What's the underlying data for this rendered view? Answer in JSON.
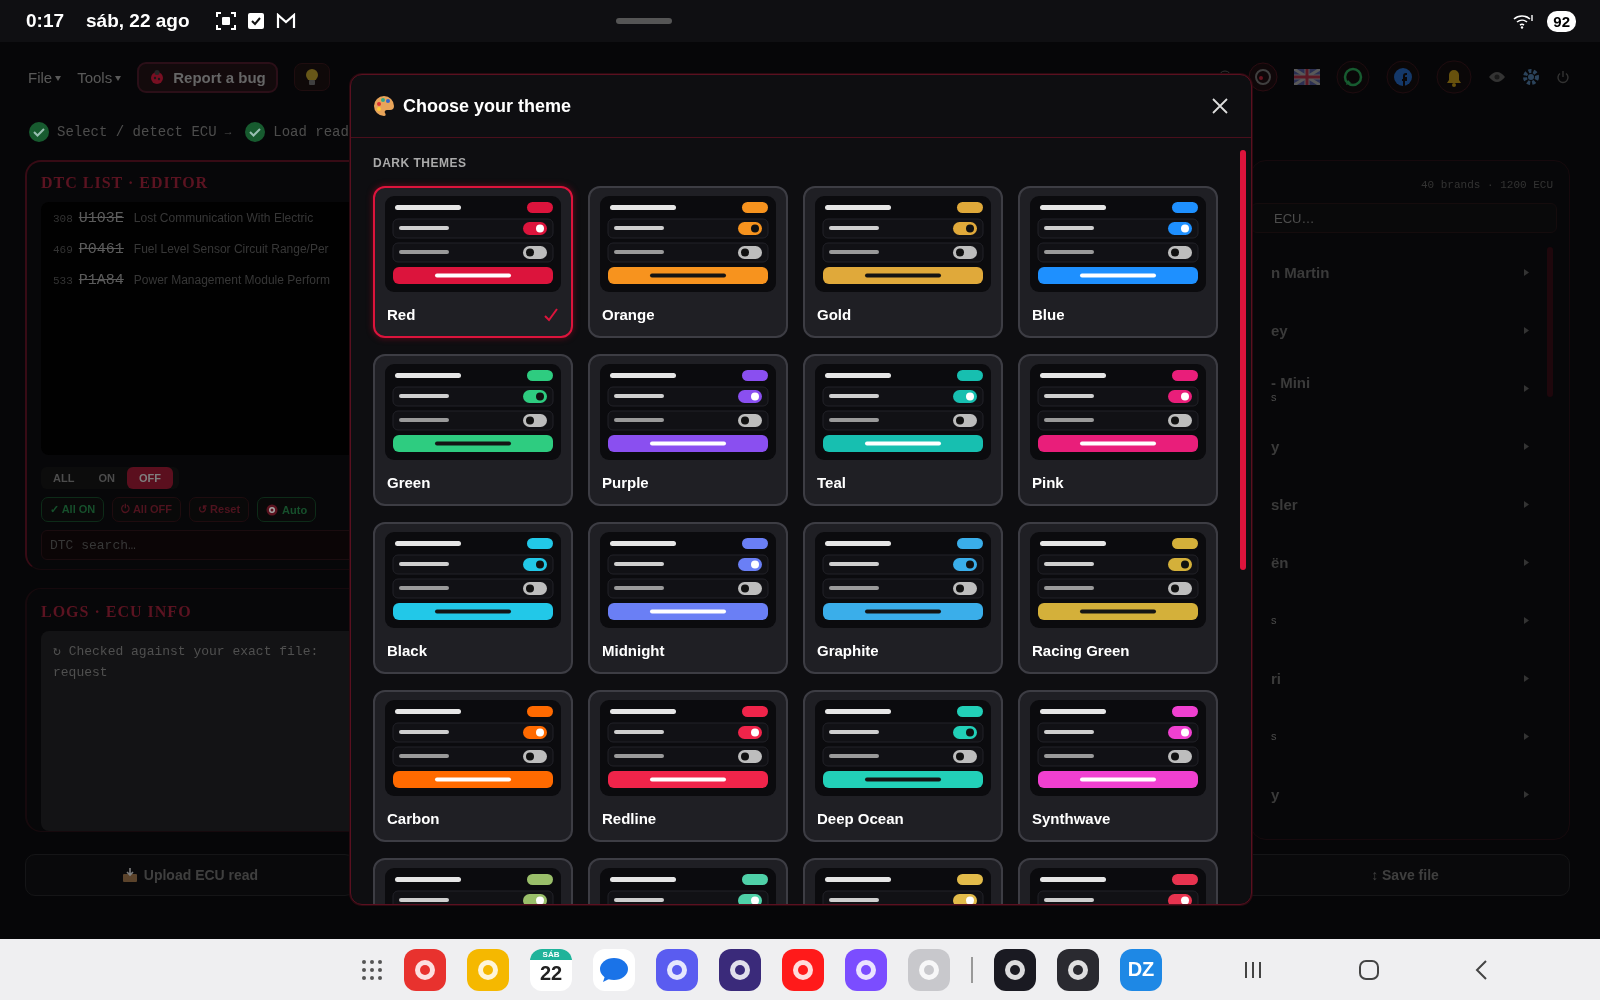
{
  "status_bar": {
    "time": "0:17",
    "date": "sáb, 22 ago",
    "battery": "92"
  },
  "toolbar": {
    "menus": [
      "File",
      "Tools"
    ],
    "report_button": "Report a bug"
  },
  "steps": [
    {
      "label": "Select / detect ECU",
      "done": true,
      "arrow": "→"
    },
    {
      "label": "Load read",
      "done": true
    }
  ],
  "dtc_panel": {
    "title": "DTC LIST · EDITOR",
    "rows": [
      {
        "index": "308",
        "code": "U103E",
        "description": "Lost Communication With Electric"
      },
      {
        "index": "469",
        "code": "P0461",
        "description": "Fuel Level Sensor Circuit Range/Per"
      },
      {
        "index": "533",
        "code": "P1A84",
        "description": "Power Management Module Perform"
      }
    ],
    "filters": [
      {
        "label": "ALL",
        "selected": false
      },
      {
        "label": "ON",
        "selected": false
      },
      {
        "label": "OFF",
        "selected": true
      }
    ],
    "actions": [
      {
        "kind": "on",
        "label": "✓ All ON"
      },
      {
        "kind": "off",
        "label": "⏻ All OFF"
      },
      {
        "kind": "reset",
        "label": "↺ Reset"
      },
      {
        "kind": "auto",
        "label": "Auto"
      }
    ],
    "search_placeholder": "DTC search…"
  },
  "logs_panel": {
    "title": "LOGS · ECU INFO",
    "lines": [
      "↻ Checked against your exact file:",
      "request"
    ]
  },
  "brands_panel": {
    "summary": "40 brands · 1200 ECU",
    "search_placeholder": "ECU…",
    "brands": [
      {
        "name": "n Martin"
      },
      {
        "name": "ey"
      },
      {
        "name": "- Mini",
        "sub": "s"
      },
      {
        "name": "y"
      },
      {
        "name": "sler"
      },
      {
        "name": "ën"
      },
      {
        "sub": "s"
      },
      {
        "name": "ri"
      },
      {
        "sub": "s"
      },
      {
        "name": "y"
      }
    ]
  },
  "bottom_buttons": [
    {
      "kind": "upload",
      "label": "Upload ECU read"
    },
    {
      "kind": "save",
      "label": "↕ Save file"
    }
  ],
  "modal": {
    "title": "Choose your theme",
    "section": "DARK THEMES",
    "themes": [
      {
        "name": "Red",
        "color": "#dc143c",
        "dark_text": false,
        "selected": true
      },
      {
        "name": "Orange",
        "color": "#f7931e",
        "dark_text": true,
        "selected": false
      },
      {
        "name": "Gold",
        "color": "#e0a93a",
        "dark_text": true,
        "selected": false
      },
      {
        "name": "Blue",
        "color": "#1e90ff",
        "dark_text": false,
        "selected": false
      },
      {
        "name": "Green",
        "color": "#2ecc80",
        "dark_text": true,
        "selected": false
      },
      {
        "name": "Purple",
        "color": "#8a4ff0",
        "dark_text": false,
        "selected": false
      },
      {
        "name": "Teal",
        "color": "#17bfb0",
        "dark_text": false,
        "selected": false
      },
      {
        "name": "Pink",
        "color": "#e91e7a",
        "dark_text": false,
        "selected": false
      },
      {
        "name": "Black",
        "color": "#22c8e8",
        "dark_text": true,
        "selected": false
      },
      {
        "name": "Midnight",
        "color": "#6a7ff5",
        "dark_text": false,
        "selected": false
      },
      {
        "name": "Graphite",
        "color": "#3aaeea",
        "dark_text": true,
        "selected": false
      },
      {
        "name": "Racing Green",
        "color": "#d4b03a",
        "dark_text": true,
        "selected": false
      },
      {
        "name": "Carbon",
        "color": "#ff6a00",
        "dark_text": false,
        "selected": false
      },
      {
        "name": "Redline",
        "color": "#f0244a",
        "dark_text": false,
        "selected": false
      },
      {
        "name": "Deep Ocean",
        "color": "#22d0b8",
        "dark_text": true,
        "selected": false
      },
      {
        "name": "Synthwave",
        "color": "#f040d0",
        "dark_text": false,
        "selected": false
      },
      {
        "color": "#9abf6a",
        "selected": false
      },
      {
        "color": "#4fd1a8",
        "selected": false
      },
      {
        "color": "#e2bb4a",
        "selected": false
      },
      {
        "color": "#e8334f",
        "selected": false
      }
    ]
  },
  "dock": {
    "apps": [
      {
        "kind": "grid"
      },
      {
        "kind": "app",
        "color": "#e8322e"
      },
      {
        "kind": "app",
        "color": "#f5b800"
      },
      {
        "kind": "calendar",
        "day": "SÁB",
        "date": "22"
      },
      {
        "kind": "bubble",
        "color": "#1a73e8"
      },
      {
        "kind": "app",
        "color": "#5a5cf0"
      },
      {
        "kind": "app",
        "color": "#3a2a7a"
      },
      {
        "kind": "app",
        "color": "#ff1a1a"
      },
      {
        "kind": "app",
        "color": "#7b4dff"
      },
      {
        "kind": "app",
        "color": "#c8c8cc"
      },
      {
        "kind": "divider"
      },
      {
        "kind": "app",
        "color": "#1a1a22"
      },
      {
        "kind": "app",
        "color": "#2a2a30"
      },
      {
        "kind": "text",
        "label": "DZ",
        "color": "#1e88e5"
      }
    ]
  }
}
